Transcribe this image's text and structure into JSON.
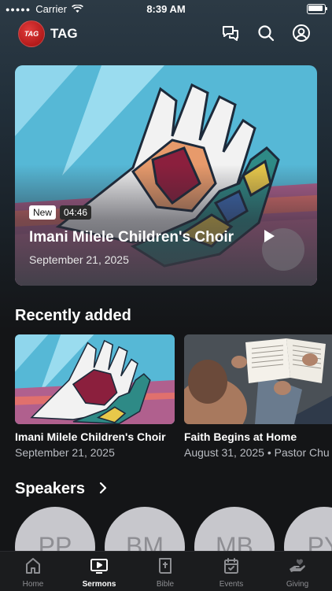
{
  "status_bar": {
    "carrier": "Carrier",
    "time": "8:39 AM"
  },
  "header": {
    "logo_text": "TAG",
    "brand": "TAG"
  },
  "hero": {
    "badge_new": "New",
    "duration": "04:46",
    "title": "Imani Milele Children's Choir",
    "date": "September 21, 2025"
  },
  "recent": {
    "title": "Recently added",
    "items": [
      {
        "title": "Imani Milele Children's Choir",
        "date": "September 21, 2025"
      },
      {
        "title": "Faith Begins at Home",
        "date": "August 31, 2025 • Pastor Chu"
      }
    ]
  },
  "speakers": {
    "title": "Speakers",
    "items": [
      {
        "initials": "PP"
      },
      {
        "initials": "BM"
      },
      {
        "initials": "MB"
      },
      {
        "initials": "PY"
      }
    ]
  },
  "tabs": [
    {
      "label": "Home",
      "icon": "home-icon"
    },
    {
      "label": "Sermons",
      "icon": "tv-play-icon",
      "active": true
    },
    {
      "label": "Bible",
      "icon": "bible-icon"
    },
    {
      "label": "Events",
      "icon": "calendar-icon"
    },
    {
      "label": "Giving",
      "icon": "giving-hand-icon"
    }
  ],
  "colors": {
    "background": "#141517",
    "tab_active": "#ffffff",
    "tab_inactive": "#8d8e92",
    "logo_red": "#c61a1a"
  }
}
